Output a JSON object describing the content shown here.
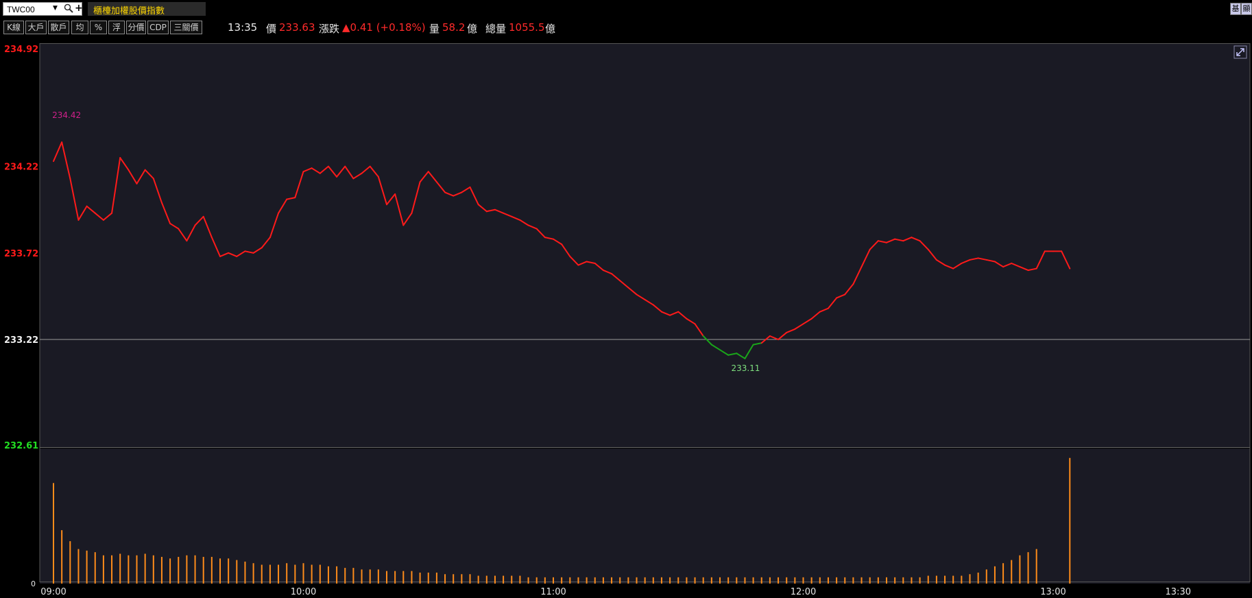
{
  "header": {
    "symbol": "TWC00",
    "index_name": "櫃檯加權股價指數",
    "corner_labels": [
      "基",
      "顯"
    ]
  },
  "toolbar": {
    "buttons": [
      "K線",
      "大戶",
      "散戶",
      "均",
      "%",
      "浮",
      "分價",
      "CDP",
      "三關價"
    ]
  },
  "quote": {
    "time": "13:35",
    "price_label": "價",
    "price": "233.63",
    "change_label": "漲跌",
    "change": "▲0.41 (+0.18%)",
    "volume_label": "量",
    "volume": "58.2",
    "volume_unit": "億",
    "total_volume_label": "總量",
    "total_volume": "1055.5",
    "total_volume_unit": "億"
  },
  "colors": {
    "up": "#ff1a1a",
    "down": "#1aa51a",
    "volume": "#ff8c1a",
    "background": "#1a1a24",
    "reference_line": "#9a9a9a",
    "high_label": "#d0208a"
  },
  "chart_data": {
    "type": "line",
    "reference_price": 233.22,
    "ylim": [
      232.61,
      234.92
    ],
    "y_ticks": [
      {
        "value": "234.92",
        "color": "up"
      },
      {
        "value": "234.22",
        "color": "up"
      },
      {
        "value": "233.72",
        "color": "up"
      },
      {
        "value": "233.22",
        "color": "neutral"
      },
      {
        "value": "232.61",
        "color": "down"
      }
    ],
    "x_ticks": [
      "09:00",
      "10:00",
      "11:00",
      "12:00",
      "13:00",
      "13:30"
    ],
    "high_annotation": "234.42",
    "low_annotation": "233.11",
    "volume_zero_label": "0",
    "price_series": [
      [
        "09:00",
        234.25
      ],
      [
        "09:02",
        234.36
      ],
      [
        "09:04",
        234.15
      ],
      [
        "09:06",
        233.91
      ],
      [
        "09:08",
        233.99
      ],
      [
        "09:10",
        233.95
      ],
      [
        "09:12",
        233.91
      ],
      [
        "09:14",
        233.95
      ],
      [
        "09:16",
        234.27
      ],
      [
        "09:18",
        234.2
      ],
      [
        "09:20",
        234.12
      ],
      [
        "09:22",
        234.2
      ],
      [
        "09:24",
        234.15
      ],
      [
        "09:26",
        234.01
      ],
      [
        "09:28",
        233.89
      ],
      [
        "09:30",
        233.86
      ],
      [
        "09:32",
        233.79
      ],
      [
        "09:34",
        233.88
      ],
      [
        "09:36",
        233.93
      ],
      [
        "09:38",
        233.81
      ],
      [
        "09:40",
        233.7
      ],
      [
        "09:42",
        233.72
      ],
      [
        "09:44",
        233.7
      ],
      [
        "09:46",
        233.73
      ],
      [
        "09:48",
        233.72
      ],
      [
        "09:50",
        233.75
      ],
      [
        "09:52",
        233.81
      ],
      [
        "09:54",
        233.95
      ],
      [
        "09:56",
        234.03
      ],
      [
        "09:58",
        234.04
      ],
      [
        "10:00",
        234.19
      ],
      [
        "10:02",
        234.21
      ],
      [
        "10:04",
        234.18
      ],
      [
        "10:06",
        234.22
      ],
      [
        "10:08",
        234.16
      ],
      [
        "10:10",
        234.22
      ],
      [
        "10:12",
        234.15
      ],
      [
        "10:14",
        234.18
      ],
      [
        "10:16",
        234.22
      ],
      [
        "10:18",
        234.16
      ],
      [
        "10:20",
        234.0
      ],
      [
        "10:22",
        234.06
      ],
      [
        "10:24",
        233.88
      ],
      [
        "10:26",
        233.95
      ],
      [
        "10:28",
        234.13
      ],
      [
        "10:30",
        234.19
      ],
      [
        "10:32",
        234.13
      ],
      [
        "10:34",
        234.07
      ],
      [
        "10:36",
        234.05
      ],
      [
        "10:38",
        234.07
      ],
      [
        "10:40",
        234.1
      ],
      [
        "10:42",
        234.0
      ],
      [
        "10:44",
        233.96
      ],
      [
        "10:46",
        233.97
      ],
      [
        "10:48",
        233.95
      ],
      [
        "10:50",
        233.93
      ],
      [
        "10:52",
        233.91
      ],
      [
        "10:54",
        233.88
      ],
      [
        "10:56",
        233.86
      ],
      [
        "10:58",
        233.81
      ],
      [
        "11:00",
        233.8
      ],
      [
        "11:02",
        233.77
      ],
      [
        "11:04",
        233.7
      ],
      [
        "11:06",
        233.65
      ],
      [
        "11:08",
        233.67
      ],
      [
        "11:10",
        233.66
      ],
      [
        "11:12",
        233.62
      ],
      [
        "11:14",
        233.6
      ],
      [
        "11:16",
        233.56
      ],
      [
        "11:18",
        233.52
      ],
      [
        "11:20",
        233.48
      ],
      [
        "11:22",
        233.45
      ],
      [
        "11:24",
        233.42
      ],
      [
        "11:26",
        233.38
      ],
      [
        "11:28",
        233.36
      ],
      [
        "11:30",
        233.38
      ],
      [
        "11:32",
        233.34
      ],
      [
        "11:34",
        233.31
      ],
      [
        "11:36",
        233.24
      ],
      [
        "11:38",
        233.19
      ],
      [
        "11:40",
        233.16
      ],
      [
        "11:42",
        233.13
      ],
      [
        "11:44",
        233.14
      ],
      [
        "11:46",
        233.11
      ],
      [
        "11:48",
        233.19
      ],
      [
        "11:50",
        233.2
      ],
      [
        "11:52",
        233.24
      ],
      [
        "11:54",
        233.22
      ],
      [
        "11:56",
        233.26
      ],
      [
        "11:58",
        233.28
      ],
      [
        "12:00",
        233.31
      ],
      [
        "12:02",
        233.34
      ],
      [
        "12:04",
        233.38
      ],
      [
        "12:06",
        233.4
      ],
      [
        "12:08",
        233.46
      ],
      [
        "12:10",
        233.48
      ],
      [
        "12:12",
        233.54
      ],
      [
        "12:14",
        233.64
      ],
      [
        "12:16",
        233.74
      ],
      [
        "12:18",
        233.79
      ],
      [
        "12:20",
        233.78
      ],
      [
        "12:22",
        233.8
      ],
      [
        "12:24",
        233.79
      ],
      [
        "12:26",
        233.81
      ],
      [
        "12:28",
        233.79
      ],
      [
        "12:30",
        233.74
      ],
      [
        "12:32",
        233.68
      ],
      [
        "12:34",
        233.65
      ],
      [
        "12:36",
        233.63
      ],
      [
        "12:38",
        233.66
      ],
      [
        "12:40",
        233.68
      ],
      [
        "12:42",
        233.69
      ],
      [
        "12:44",
        233.68
      ],
      [
        "12:46",
        233.67
      ],
      [
        "12:48",
        233.64
      ],
      [
        "12:50",
        233.66
      ],
      [
        "12:52",
        233.64
      ],
      [
        "12:54",
        233.62
      ],
      [
        "12:56",
        233.63
      ],
      [
        "12:58",
        233.73
      ],
      [
        "13:00",
        233.73
      ],
      [
        "13:02",
        233.73
      ],
      [
        "13:04",
        233.63
      ]
    ],
    "volume_series": [
      [
        "09:00",
        6.4
      ],
      [
        "09:02",
        3.4
      ],
      [
        "09:04",
        2.7
      ],
      [
        "09:06",
        2.2
      ],
      [
        "09:08",
        2.1
      ],
      [
        "09:10",
        2.0
      ],
      [
        "09:12",
        1.8
      ],
      [
        "09:14",
        1.8
      ],
      [
        "09:16",
        1.9
      ],
      [
        "09:18",
        1.8
      ],
      [
        "09:20",
        1.8
      ],
      [
        "09:22",
        1.9
      ],
      [
        "09:24",
        1.8
      ],
      [
        "09:26",
        1.7
      ],
      [
        "09:28",
        1.6
      ],
      [
        "09:30",
        1.7
      ],
      [
        "09:32",
        1.8
      ],
      [
        "09:34",
        1.8
      ],
      [
        "09:36",
        1.7
      ],
      [
        "09:38",
        1.7
      ],
      [
        "09:40",
        1.6
      ],
      [
        "09:42",
        1.6
      ],
      [
        "09:44",
        1.5
      ],
      [
        "09:46",
        1.4
      ],
      [
        "09:48",
        1.3
      ],
      [
        "09:50",
        1.2
      ],
      [
        "09:52",
        1.2
      ],
      [
        "09:54",
        1.2
      ],
      [
        "09:56",
        1.3
      ],
      [
        "09:58",
        1.2
      ],
      [
        "10:00",
        1.3
      ],
      [
        "10:02",
        1.2
      ],
      [
        "10:04",
        1.2
      ],
      [
        "10:06",
        1.1
      ],
      [
        "10:08",
        1.1
      ],
      [
        "10:10",
        1.0
      ],
      [
        "10:12",
        1.0
      ],
      [
        "10:14",
        0.9
      ],
      [
        "10:16",
        0.9
      ],
      [
        "10:18",
        0.9
      ],
      [
        "10:20",
        0.8
      ],
      [
        "10:22",
        0.8
      ],
      [
        "10:24",
        0.8
      ],
      [
        "10:26",
        0.8
      ],
      [
        "10:28",
        0.7
      ],
      [
        "10:30",
        0.7
      ],
      [
        "10:32",
        0.7
      ],
      [
        "10:34",
        0.6
      ],
      [
        "10:36",
        0.6
      ],
      [
        "10:38",
        0.6
      ],
      [
        "10:40",
        0.6
      ],
      [
        "10:42",
        0.5
      ],
      [
        "10:44",
        0.5
      ],
      [
        "10:46",
        0.5
      ],
      [
        "10:48",
        0.5
      ],
      [
        "10:50",
        0.5
      ],
      [
        "10:52",
        0.5
      ],
      [
        "10:54",
        0.4
      ],
      [
        "10:56",
        0.4
      ],
      [
        "10:58",
        0.4
      ],
      [
        "11:00",
        0.4
      ],
      [
        "11:02",
        0.4
      ],
      [
        "11:04",
        0.4
      ],
      [
        "11:06",
        0.4
      ],
      [
        "11:08",
        0.4
      ],
      [
        "11:10",
        0.4
      ],
      [
        "11:12",
        0.4
      ],
      [
        "11:14",
        0.4
      ],
      [
        "11:16",
        0.4
      ],
      [
        "11:18",
        0.4
      ],
      [
        "11:20",
        0.4
      ],
      [
        "11:22",
        0.4
      ],
      [
        "11:24",
        0.4
      ],
      [
        "11:26",
        0.4
      ],
      [
        "11:28",
        0.4
      ],
      [
        "11:30",
        0.4
      ],
      [
        "11:32",
        0.4
      ],
      [
        "11:34",
        0.4
      ],
      [
        "11:36",
        0.4
      ],
      [
        "11:38",
        0.4
      ],
      [
        "11:40",
        0.4
      ],
      [
        "11:42",
        0.4
      ],
      [
        "11:44",
        0.4
      ],
      [
        "11:46",
        0.4
      ],
      [
        "11:48",
        0.4
      ],
      [
        "11:50",
        0.4
      ],
      [
        "11:52",
        0.4
      ],
      [
        "11:54",
        0.4
      ],
      [
        "11:56",
        0.4
      ],
      [
        "11:58",
        0.4
      ],
      [
        "12:00",
        0.4
      ],
      [
        "12:02",
        0.4
      ],
      [
        "12:04",
        0.4
      ],
      [
        "12:06",
        0.4
      ],
      [
        "12:08",
        0.4
      ],
      [
        "12:10",
        0.4
      ],
      [
        "12:12",
        0.4
      ],
      [
        "12:14",
        0.4
      ],
      [
        "12:16",
        0.4
      ],
      [
        "12:18",
        0.4
      ],
      [
        "12:20",
        0.4
      ],
      [
        "12:22",
        0.4
      ],
      [
        "12:24",
        0.4
      ],
      [
        "12:26",
        0.4
      ],
      [
        "12:28",
        0.4
      ],
      [
        "12:30",
        0.5
      ],
      [
        "12:32",
        0.5
      ],
      [
        "12:34",
        0.5
      ],
      [
        "12:36",
        0.5
      ],
      [
        "12:38",
        0.5
      ],
      [
        "12:40",
        0.6
      ],
      [
        "12:42",
        0.7
      ],
      [
        "12:44",
        0.9
      ],
      [
        "12:46",
        1.1
      ],
      [
        "12:48",
        1.3
      ],
      [
        "12:50",
        1.5
      ],
      [
        "12:52",
        1.8
      ],
      [
        "12:54",
        2.0
      ],
      [
        "12:56",
        2.2
      ],
      [
        "12:58",
        0.0
      ],
      [
        "13:00",
        0.0
      ],
      [
        "13:02",
        0.0
      ],
      [
        "13:04",
        8.0
      ]
    ]
  }
}
